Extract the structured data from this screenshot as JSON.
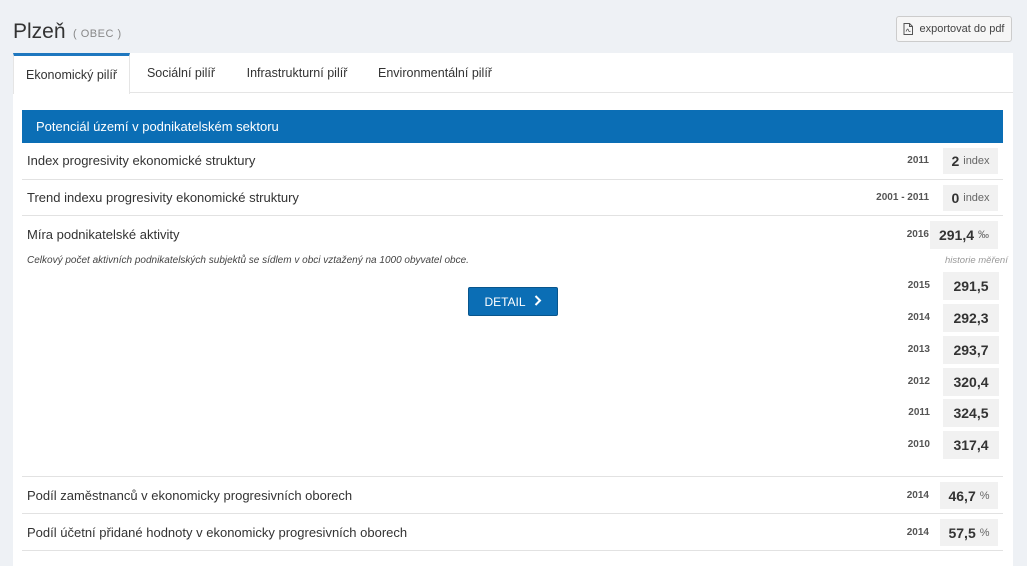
{
  "header": {
    "title": "Plzeň",
    "type_label": "( OBEC )",
    "export_label": "exportovat do pdf"
  },
  "tabs": [
    {
      "label": "Ekonomický pilíř",
      "active": true
    },
    {
      "label": "Sociální pilíř",
      "active": false
    },
    {
      "label": "Infrastrukturní pilíř",
      "active": false
    },
    {
      "label": "Environmentální pilíř",
      "active": false
    }
  ],
  "section": {
    "title": "Potenciál území v podnikatelském sektoru"
  },
  "indicators": [
    {
      "label": "Index progresivity ekonomické struktury",
      "year": "2011",
      "value": "2",
      "unit": "index"
    },
    {
      "label": "Trend indexu progresivity ekonomické struktury",
      "year": "2001 - 2011",
      "value": "0",
      "unit": "index"
    },
    {
      "label": "Míra podnikatelské aktivity",
      "year": "2016",
      "value": "291,4",
      "unit": "‰"
    },
    {
      "label": "Podíl zaměstnanců v ekonomicky progresivních oborech",
      "year": "2014",
      "value": "46,7",
      "unit": "%"
    },
    {
      "label": "Podíl účetní přidané hodnoty v ekonomicky progresivních oborech",
      "year": "2014",
      "value": "57,5",
      "unit": "%"
    }
  ],
  "expanded": {
    "description": "Celkový počet aktivních podnikatelských subjektů se sídlem v obci vztažený na 1000 obyvatel obce.",
    "history_label": "historie měření",
    "detail_label": "DETAIL",
    "history": [
      {
        "year": "2015",
        "value": "291,5"
      },
      {
        "year": "2014",
        "value": "292,3"
      },
      {
        "year": "2013",
        "value": "293,7"
      },
      {
        "year": "2012",
        "value": "320,4"
      },
      {
        "year": "2011",
        "value": "324,5"
      },
      {
        "year": "2010",
        "value": "317,4"
      }
    ]
  },
  "colors": {
    "accent": "#0b6eb5",
    "tab_active_border": "#1e77bf",
    "value_bg": "#f1f1f1"
  }
}
